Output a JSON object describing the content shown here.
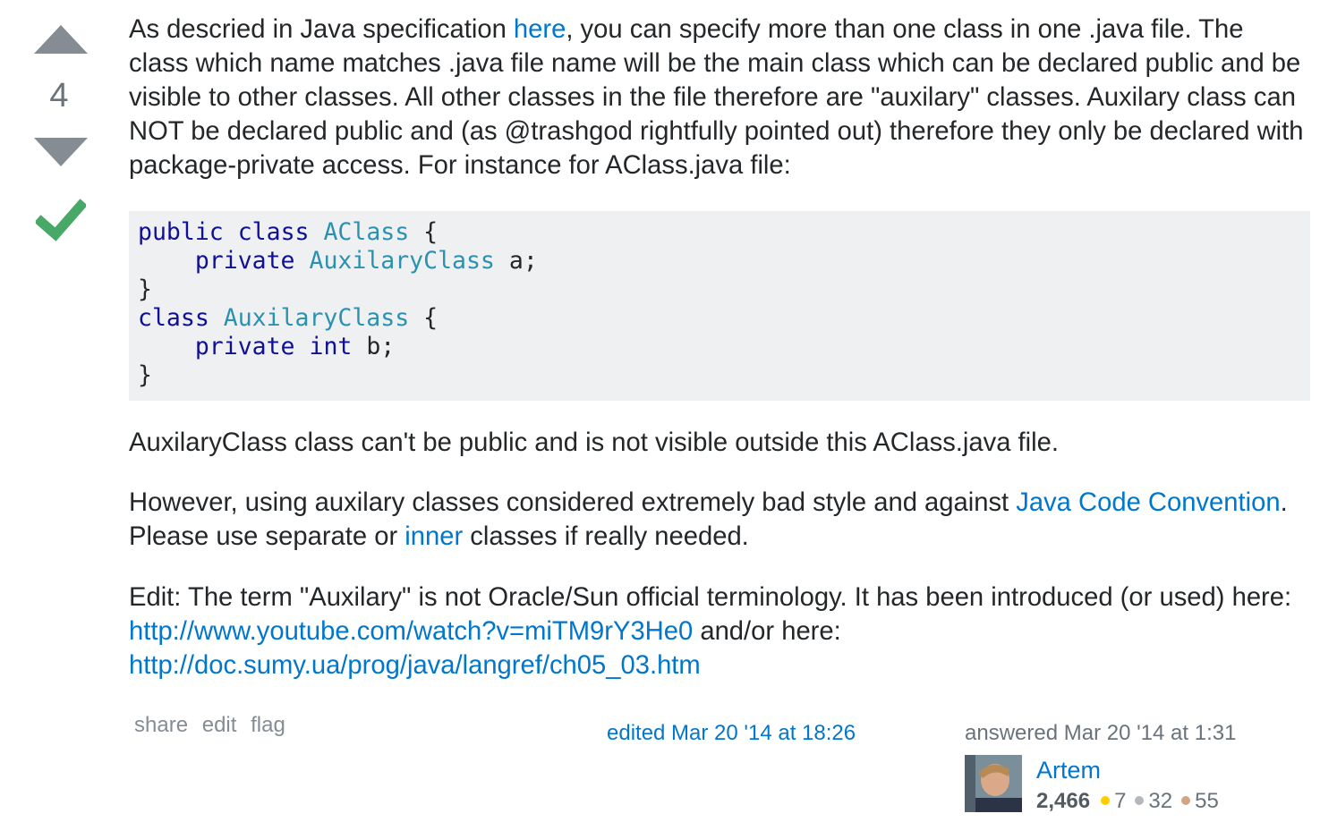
{
  "vote": {
    "count": "4",
    "accepted": true
  },
  "answer": {
    "p1_text_a": "As descried in Java specification ",
    "p1_link_here": "here",
    "p1_text_b": ", you can specify more than one class in one .java file. The class which name matches .java file name will be the main class which can be declared public and be visible to other classes. All other classes in the file therefore are \"auxilary\" classes. Auxilary class can NOT be declared public and (as @trashgod rightfully pointed out) therefore they only be declared with package-private access. For instance for AClass.java file:",
    "code": {
      "l1_kw1": "public",
      "l1_kw2": "class",
      "l1_type": "AClass",
      "l1_rest": " {",
      "l2_indent": "    ",
      "l2_kw": "private",
      "l2_type": "AuxilaryClass",
      "l2_rest": " a;",
      "l3": "}",
      "l4_kw": "class",
      "l4_type": "AuxilaryClass",
      "l4_rest": " {",
      "l5_indent": "    ",
      "l5_kw1": "private",
      "l5_kw2": "int",
      "l5_rest": " b;",
      "l6": "}"
    },
    "p2_text": "AuxilaryClass class can't be public and is not visible outside this AClass.java file.",
    "p3_text_a": "However, using auxilary classes considered extremely bad style and against ",
    "p3_link_convention": "Java Code Convention",
    "p3_text_b": ". Please use separate or ",
    "p3_link_inner": "inner",
    "p3_text_c": " classes if really needed.",
    "p4_text_a": "Edit: The term \"Auxilary\" is not Oracle/Sun official terminology. It has been introduced (or used) here: ",
    "p4_link_youtube": "http://www.youtube.com/watch?v=miTM9rY3He0",
    "p4_text_b": " and/or here: ",
    "p4_link_doc": "http://doc.sumy.ua/prog/java/langref/ch05_03.htm"
  },
  "menu": {
    "share": "share",
    "edit": "edit",
    "flag": "flag"
  },
  "edited": "edited Mar 20 '14 at 18:26",
  "answered": "answered Mar 20 '14 at 1:31",
  "user": {
    "name": "Artem",
    "reputation": "2,466",
    "gold": "7",
    "silver": "32",
    "bronze": "55"
  },
  "colors": {
    "link": "#0077cc",
    "accepted": "#48a868",
    "vote_arrow": "#858c93",
    "code_bg": "#eff0f1",
    "keyword": "#101094",
    "type": "#2b91af"
  }
}
